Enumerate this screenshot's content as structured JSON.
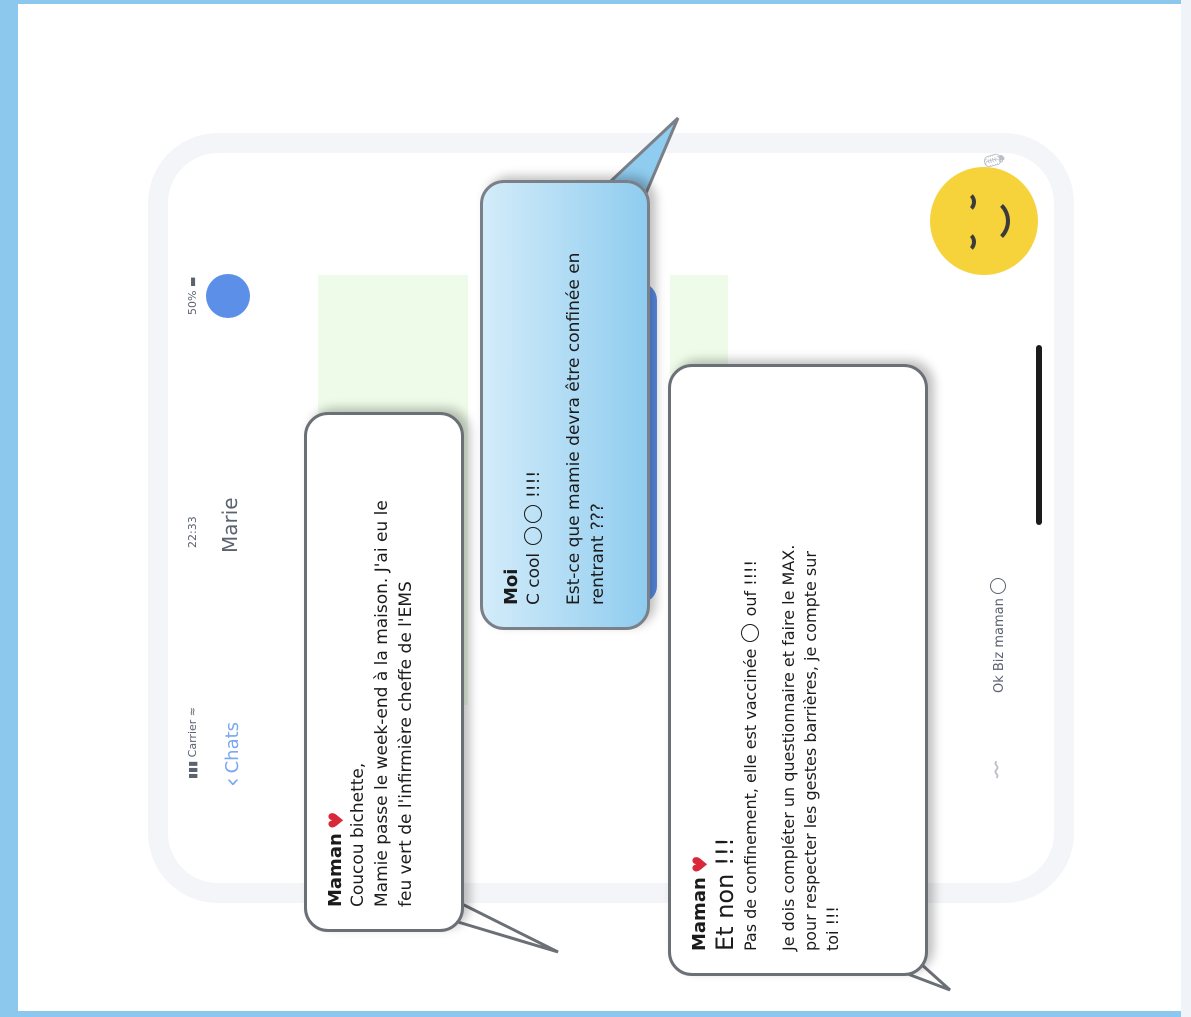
{
  "status_bar": {
    "carrier": "Carrier",
    "time": "22:33",
    "battery": "50%"
  },
  "header": {
    "back_label": "Chats",
    "contact_name": "Marie"
  },
  "messages": [
    {
      "sender": "Maman",
      "lines": [
        "Coucou bichette,",
        "Mamie passe le week-end à la maison. J'ai eu le",
        "feu vert de l'infirmière cheffe de l'EMS"
      ]
    },
    {
      "sender": "Moi",
      "line1_prefix": "C cool",
      "line1_suffix": "!!!!",
      "line2": "Est-ce que mamie devra être confinée en",
      "line3": "rentrant ???"
    },
    {
      "sender": "Maman",
      "headline": "Et non !!!",
      "line1_prefix": "Pas de confinement, elle est vaccinée",
      "line1_suffix": "ouf !!!!",
      "line2": "Je dois compléter un questionnaire et faire le MAX.",
      "line3": "pour respecter les gestes barrières,  je compte sur",
      "line4": "toi !!!"
    }
  ],
  "composer": {
    "text": "Ok Biz maman"
  },
  "colors": {
    "frame": "#8cc8ee",
    "heart": "#d8283a",
    "accent_blue": "#5b8fe8",
    "smiley_yellow": "#f6d33b"
  },
  "icons": [
    "signal-icon",
    "wifi-icon",
    "battery-icon",
    "back-chevron-icon",
    "paperclip-icon",
    "sticker-icon",
    "mic-icon",
    "heart-icon",
    "smiley-icon"
  ]
}
